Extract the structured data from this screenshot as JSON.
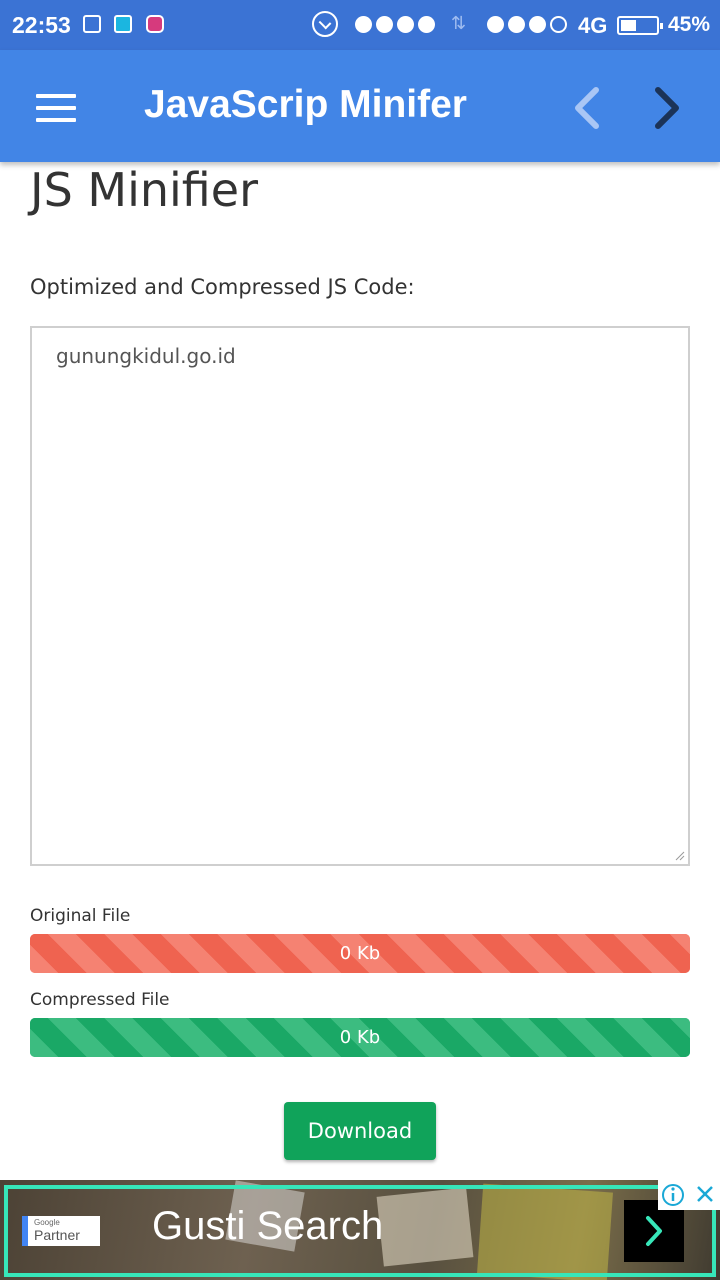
{
  "status_bar": {
    "time": "22:53",
    "network": "4G",
    "battery_percent": "45%",
    "battery_level": 0.45,
    "icons": [
      "bbm-icon",
      "mi-icon",
      "instagram-icon",
      "alarm-icon",
      "signal-dots-icon",
      "data-arrows-icon",
      "battery-icon"
    ]
  },
  "app_bar": {
    "title": "JavaScrip Minifer",
    "menu_icon": "hamburger-menu-icon",
    "back_icon": "chevron-left-icon",
    "forward_icon": "chevron-right-icon"
  },
  "main": {
    "page_title": "JS Minifier",
    "code_label": "Optimized and Compressed JS Code:",
    "code_value": "gunungkidul.go.id",
    "original": {
      "label": "Original File",
      "size_text": "0 Kb",
      "fill": 1.0,
      "color": "#f0614d"
    },
    "compressed": {
      "label": "Compressed File",
      "size_text": "0 Kb",
      "fill": 1.0,
      "color": "#17a768"
    },
    "download_label": "Download"
  },
  "ad": {
    "badge_small": "Google",
    "badge_big": "Partner",
    "headline": "Gusti Search",
    "accent_color": "#37e6b9",
    "icons": [
      "info-icon",
      "close-icon",
      "chevron-right-icon"
    ]
  }
}
